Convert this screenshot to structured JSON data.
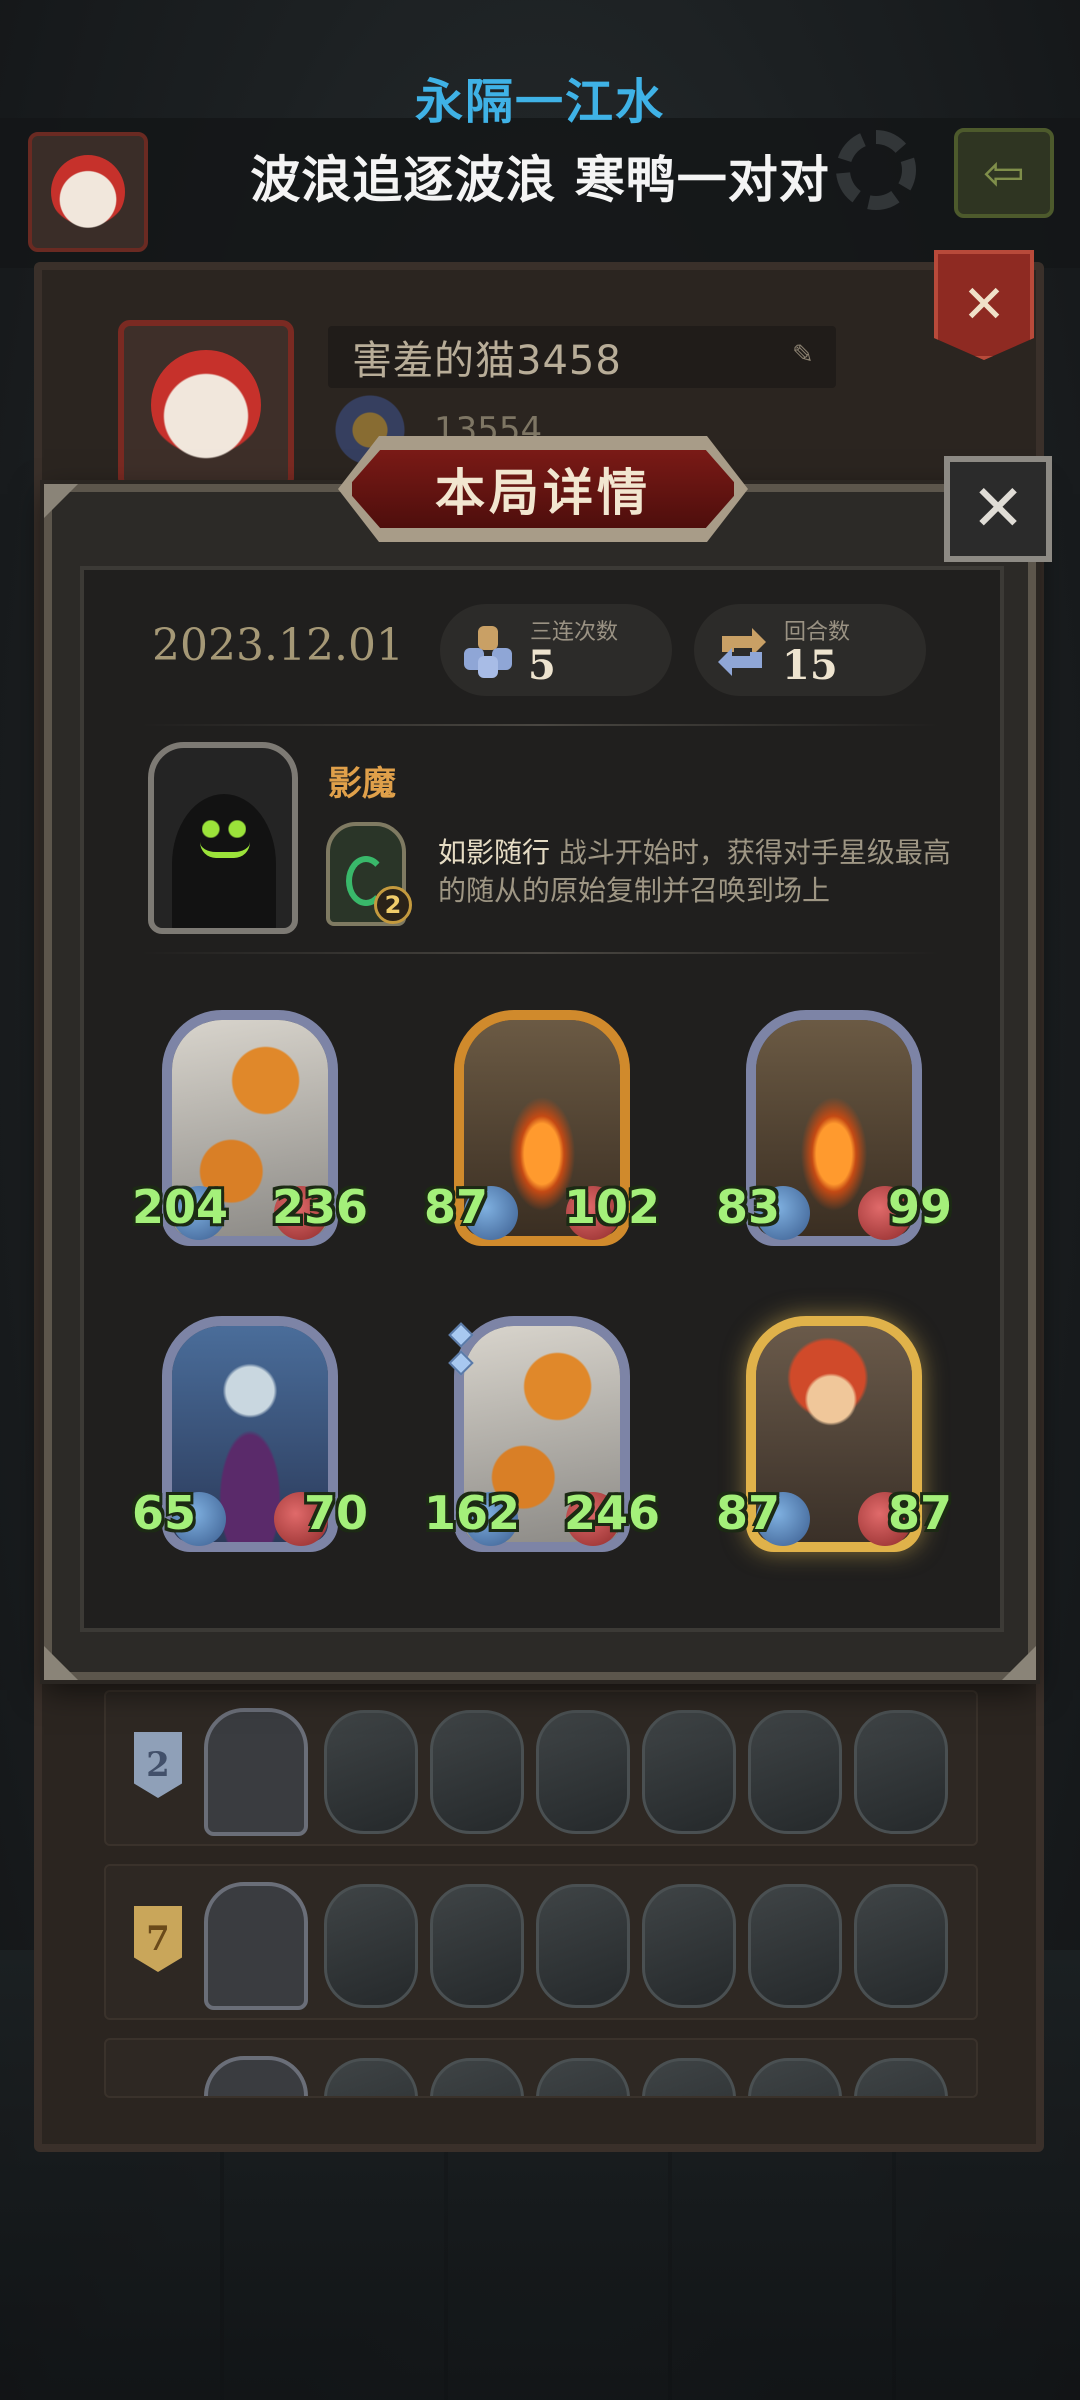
{
  "lyrics": {
    "line1": "永隔一江水",
    "line2": "波浪追逐波浪 寒鸭一对对"
  },
  "profile": {
    "name": "害羞的猫3458",
    "score": "13554"
  },
  "modal": {
    "title": "本局详情",
    "close_label": "✕",
    "date": "2023.12.01",
    "triples_label": "三连次数",
    "triples_value": "5",
    "rounds_label": "回合数",
    "rounds_value": "15",
    "hero": {
      "name": "影魔",
      "skill_level": "2",
      "skill_name": "如影随行",
      "skill_text": "战斗开始时，获得对手星级最高的随从的原始复制并召唤到场上"
    },
    "minions": [
      {
        "art": "pumpkin",
        "frame": "silver",
        "attack": "204",
        "health": "236"
      },
      {
        "art": "tree",
        "frame": "gold",
        "attack": "87",
        "health": "102"
      },
      {
        "art": "tree",
        "frame": "silver",
        "attack": "83",
        "health": "99"
      },
      {
        "art": "elf",
        "frame": "silver",
        "attack": "65",
        "health": "70"
      },
      {
        "art": "pumpkin",
        "frame": "silver",
        "attack": "162",
        "health": "246"
      },
      {
        "art": "archer",
        "frame": "golden",
        "attack": "87",
        "health": "87"
      }
    ]
  },
  "history": [
    {
      "rank": "2"
    },
    {
      "rank": "7"
    }
  ],
  "colors": {
    "accent_red": "#7a1a16",
    "stat_green": "#a4f07a",
    "hero_name": "#e0a04a",
    "lyric_blue": "#3fb2e6"
  },
  "icons": {
    "triples": "stacked-units-icon",
    "rounds": "cycle-arrows-icon",
    "settings": "gear-icon",
    "back": "back-arrow-icon",
    "edit": "pencil-icon"
  }
}
